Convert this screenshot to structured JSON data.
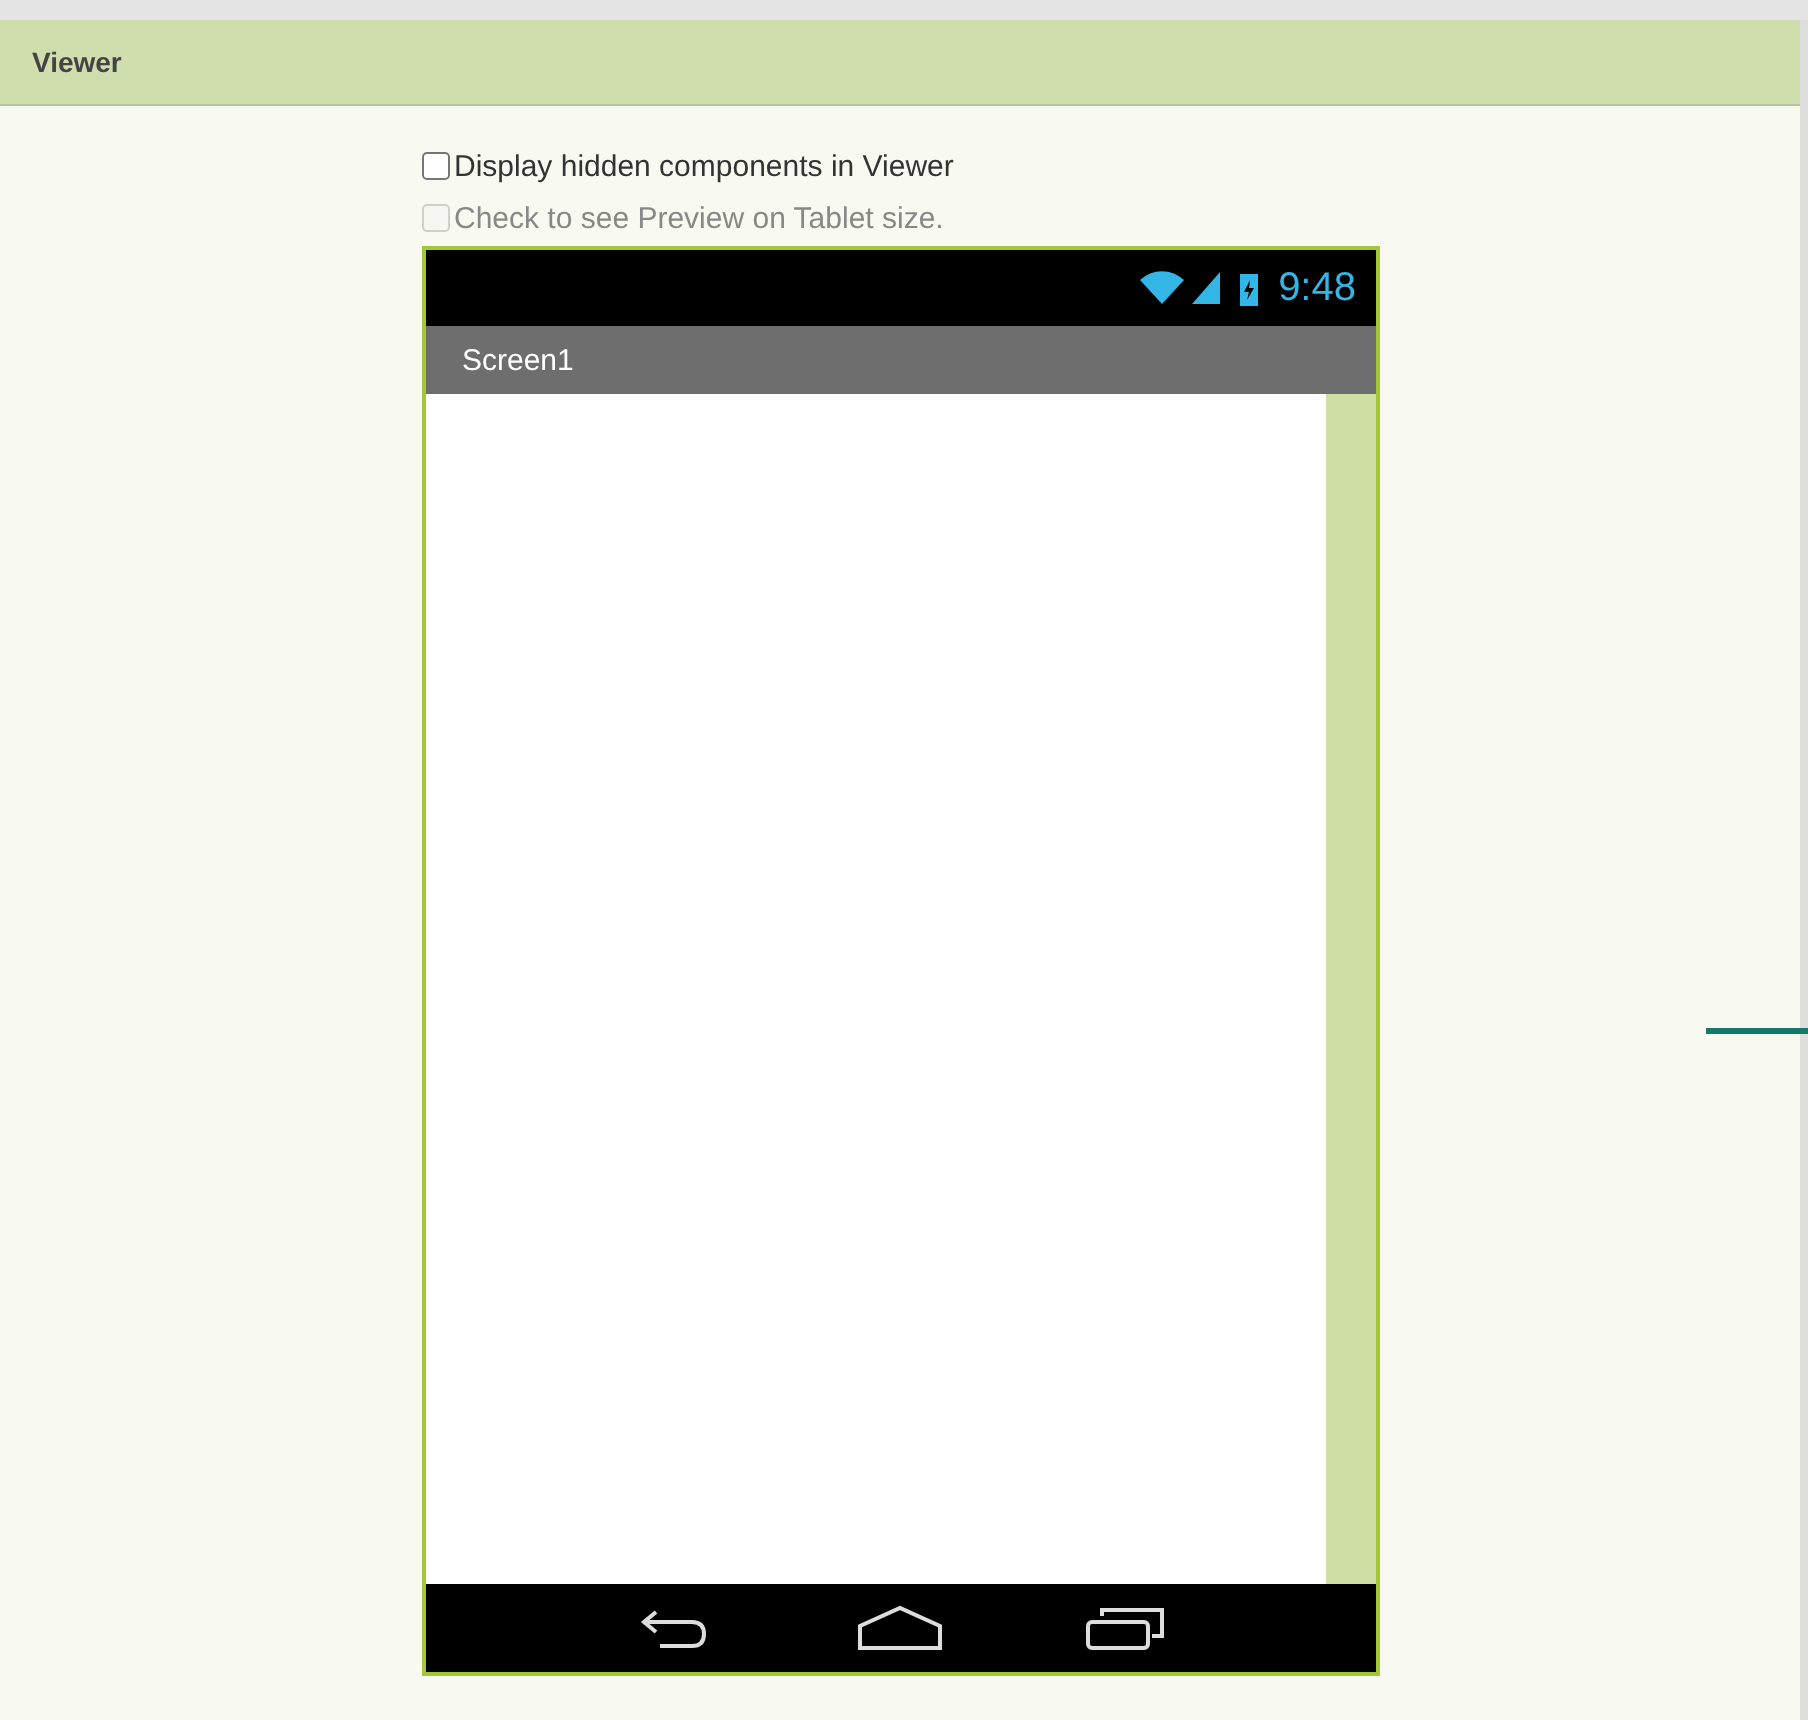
{
  "panel": {
    "title": "Viewer"
  },
  "checkboxes": [
    {
      "label": "Display hidden components in Viewer",
      "checked": false,
      "disabled": false
    },
    {
      "label": "Check to see Preview on Tablet size.",
      "checked": false,
      "disabled": true
    }
  ],
  "phone": {
    "time": "9:48",
    "screen_title": "Screen1"
  }
}
